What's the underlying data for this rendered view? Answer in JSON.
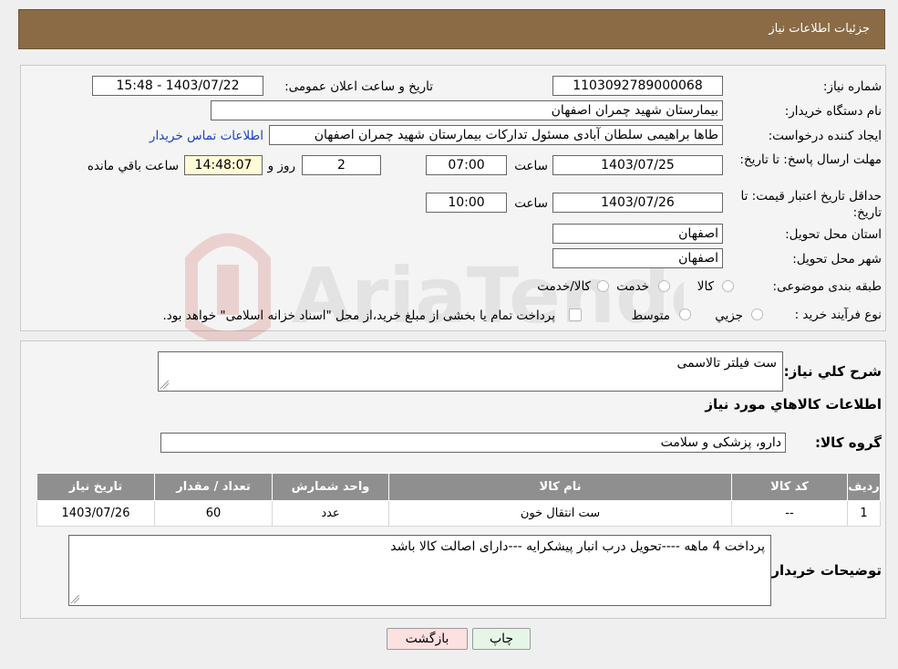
{
  "header": {
    "title": "جزئیات اطلاعات نیاز"
  },
  "labels": {
    "need_number": "شماره نیاز:",
    "announce_datetime": "تاریخ و ساعت اعلان عمومی:",
    "buyer_org": "نام دستگاه خریدار:",
    "request_creator": "ایجاد کننده درخواست:",
    "contact_link": "اطلاعات تماس خریدار",
    "reply_deadline": "مهلت ارسال پاسخ: تا تاریخ:",
    "hour": "ساعت",
    "day_and": "روز و",
    "remaining": "ساعت باقي مانده",
    "price_validity": "حداقل تاريخ اعتبار قيمت: تا تاريخ:",
    "delivery_province": "استان محل تحویل:",
    "delivery_city": "شهر محل تحویل:",
    "category": "طبقه بندی موضوعی:",
    "purchase_type": "نوع فرآیند خرید :",
    "general_desc": "شرح کلي نياز:",
    "goods_info": "اطلاعات کالاهاي مورد نياز",
    "goods_group": "گروه کالا:",
    "buyer_notes": "توضيحات خريدار:"
  },
  "values": {
    "need_number": "1103092789000068",
    "announce_datetime": "1403/07/22 - 15:48",
    "buyer_org": "بیمارستان شهید چمران اصفهان",
    "request_creator": "طاها براهیمی سلطان آبادی مسئول تدارکات  بیمارستان شهید چمران اصفهان",
    "reply_date": "1403/07/25",
    "reply_time": "07:00",
    "remaining_days": "2",
    "remaining_time": "14:48:07",
    "validity_date": "1403/07/26",
    "validity_time": "10:00",
    "delivery_province": "اصفهان",
    "delivery_city": "اصفهان",
    "general_desc": "ست فیلتر تالاسمی",
    "goods_group": "دارو، پزشکی و سلامت",
    "buyer_notes": "پرداخت 4 ماهه ----تحویل درب انبار پیشکرایه ---دارای اصالت کالا باشد"
  },
  "category_options": [
    "کالا",
    "خدمت",
    "کالا/خدمت"
  ],
  "purchase_options": [
    "جزیي",
    "متوسط"
  ],
  "payment_note": "پرداخت تمام یا بخشی از مبلغ خرید،از محل \"اسناد خزانه اسلامی\" خواهد بود.",
  "table": {
    "headers": [
      "رديف",
      "کد کالا",
      "نام کالا",
      "واحد شمارش",
      "تعداد / مقدار",
      "تاريخ نياز"
    ],
    "rows": [
      [
        "1",
        "--",
        "ست انتقال خون",
        "عدد",
        "60",
        "1403/07/26"
      ]
    ]
  },
  "buttons": {
    "back": "بازگشت",
    "print": "چاپ"
  },
  "watermark": "AriaTender.neT"
}
